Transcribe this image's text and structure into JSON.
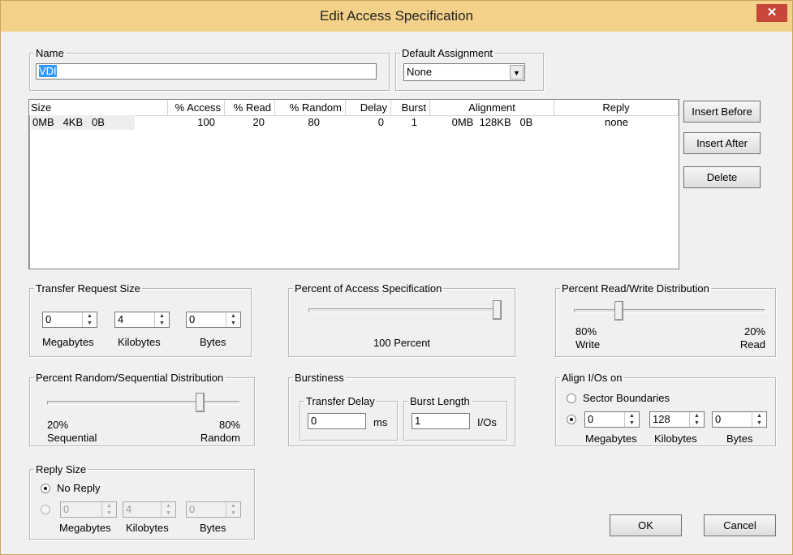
{
  "window": {
    "title": "Edit Access Specification",
    "close_glyph": "✕"
  },
  "name_group": {
    "legend": "Name",
    "value": "VDI"
  },
  "default_assignment": {
    "legend": "Default Assignment",
    "selected": "None"
  },
  "list": {
    "columns": [
      "Size",
      "% Access",
      "% Read",
      "% Random",
      "Delay",
      "Burst",
      "Alignment",
      "Reply"
    ],
    "rows": [
      {
        "size": "0MB   4KB   0B",
        "access": "100",
        "read": "20",
        "random": "80",
        "delay": "0",
        "burst": "1",
        "alignment": "0MB  128KB   0B",
        "reply": "none"
      }
    ]
  },
  "buttons": {
    "insert_before": "Insert Before",
    "insert_after": "Insert After",
    "delete": "Delete",
    "ok": "OK",
    "cancel": "Cancel"
  },
  "transfer_request_size": {
    "legend": "Transfer Request Size",
    "megabytes": "0",
    "kilobytes": "4",
    "bytes": "0",
    "mb_label": "Megabytes",
    "kb_label": "Kilobytes",
    "b_label": "Bytes"
  },
  "percent_access": {
    "legend": "Percent of Access Specification",
    "value_text": "100 Percent",
    "value": 100
  },
  "read_write": {
    "legend": "Percent Read/Write Distribution",
    "left_pct": "80%",
    "left_label": "Write",
    "right_pct": "20%",
    "right_label": "Read",
    "write_fraction": 0.8
  },
  "random_sequential": {
    "legend": "Percent Random/Sequential Distribution",
    "left_pct": "20%",
    "left_label": "Sequential",
    "right_pct": "80%",
    "right_label": "Random",
    "random_fraction": 0.8
  },
  "burstiness": {
    "legend": "Burstiness",
    "transfer_delay_legend": "Transfer Delay",
    "transfer_delay": "0",
    "delay_unit": "ms",
    "burst_length_legend": "Burst Length",
    "burst_length": "1",
    "burst_unit": "I/Os"
  },
  "align": {
    "legend": "Align I/Os on",
    "sector_label": "Sector Boundaries",
    "megabytes": "0",
    "kilobytes": "128",
    "bytes": "0",
    "mb_label": "Megabytes",
    "kb_label": "Kilobytes",
    "b_label": "Bytes",
    "selected": "custom"
  },
  "reply_size": {
    "legend": "Reply Size",
    "no_reply_label": "No Reply",
    "megabytes": "0",
    "kilobytes": "4",
    "bytes": "0",
    "mb_label": "Megabytes",
    "kb_label": "Kilobytes",
    "b_label": "Bytes",
    "selected": "no_reply"
  }
}
